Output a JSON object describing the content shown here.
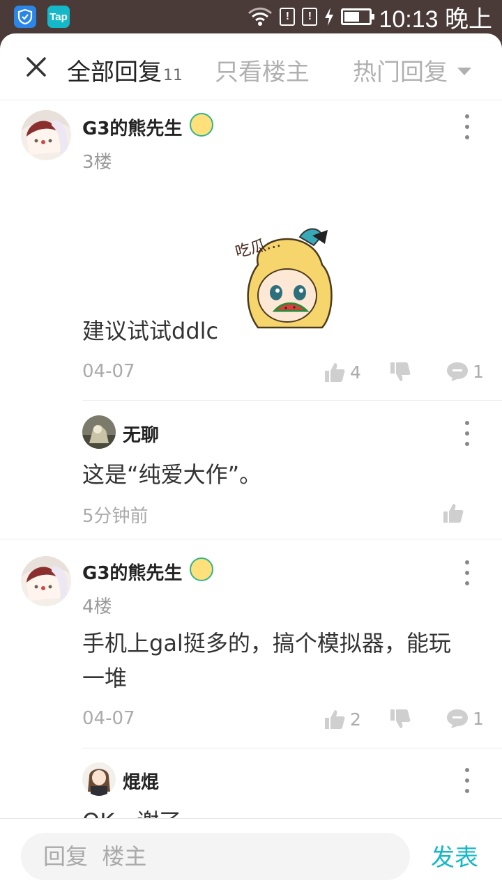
{
  "status_bar": {
    "time": "10:13 晚上",
    "app2_label": "Tap",
    "sim1": "!",
    "sim2": "!",
    "battery_level": 0.55
  },
  "header": {
    "tab_all": "全部回复",
    "tab_all_count": "11",
    "tab_owner": "只看楼主",
    "tab_hot": "热门回复"
  },
  "replies": [
    {
      "user": "G3的熊先生",
      "floor": "3楼",
      "text": "建议试试ddlc",
      "sticker_text": "吃瓜…",
      "date": "04-07",
      "likes": "4",
      "comments": "1",
      "sub": {
        "user": "无聊",
        "text": "这是“纯爱大作”。",
        "time": "5分钟前"
      }
    },
    {
      "user": "G3的熊先生",
      "floor": "4楼",
      "text_line1": "手机上gal挺多的，搞个模拟器，能玩",
      "text_line2": "一堆",
      "date": "04-07",
      "likes": "2",
      "comments": "1",
      "sub": {
        "user": "焜焜",
        "text": "OK，谢了"
      }
    }
  ],
  "footer": {
    "placeholder": "回复  楼主",
    "send": "发表"
  },
  "colors": {
    "accent": "#15b8c8",
    "status_bar": "#4a3a38"
  },
  "icons": [
    "close-icon",
    "chevron-down-icon",
    "more-icon",
    "thumb-up-icon",
    "thumb-down-icon",
    "comment-icon",
    "wifi-icon",
    "battery-icon"
  ]
}
